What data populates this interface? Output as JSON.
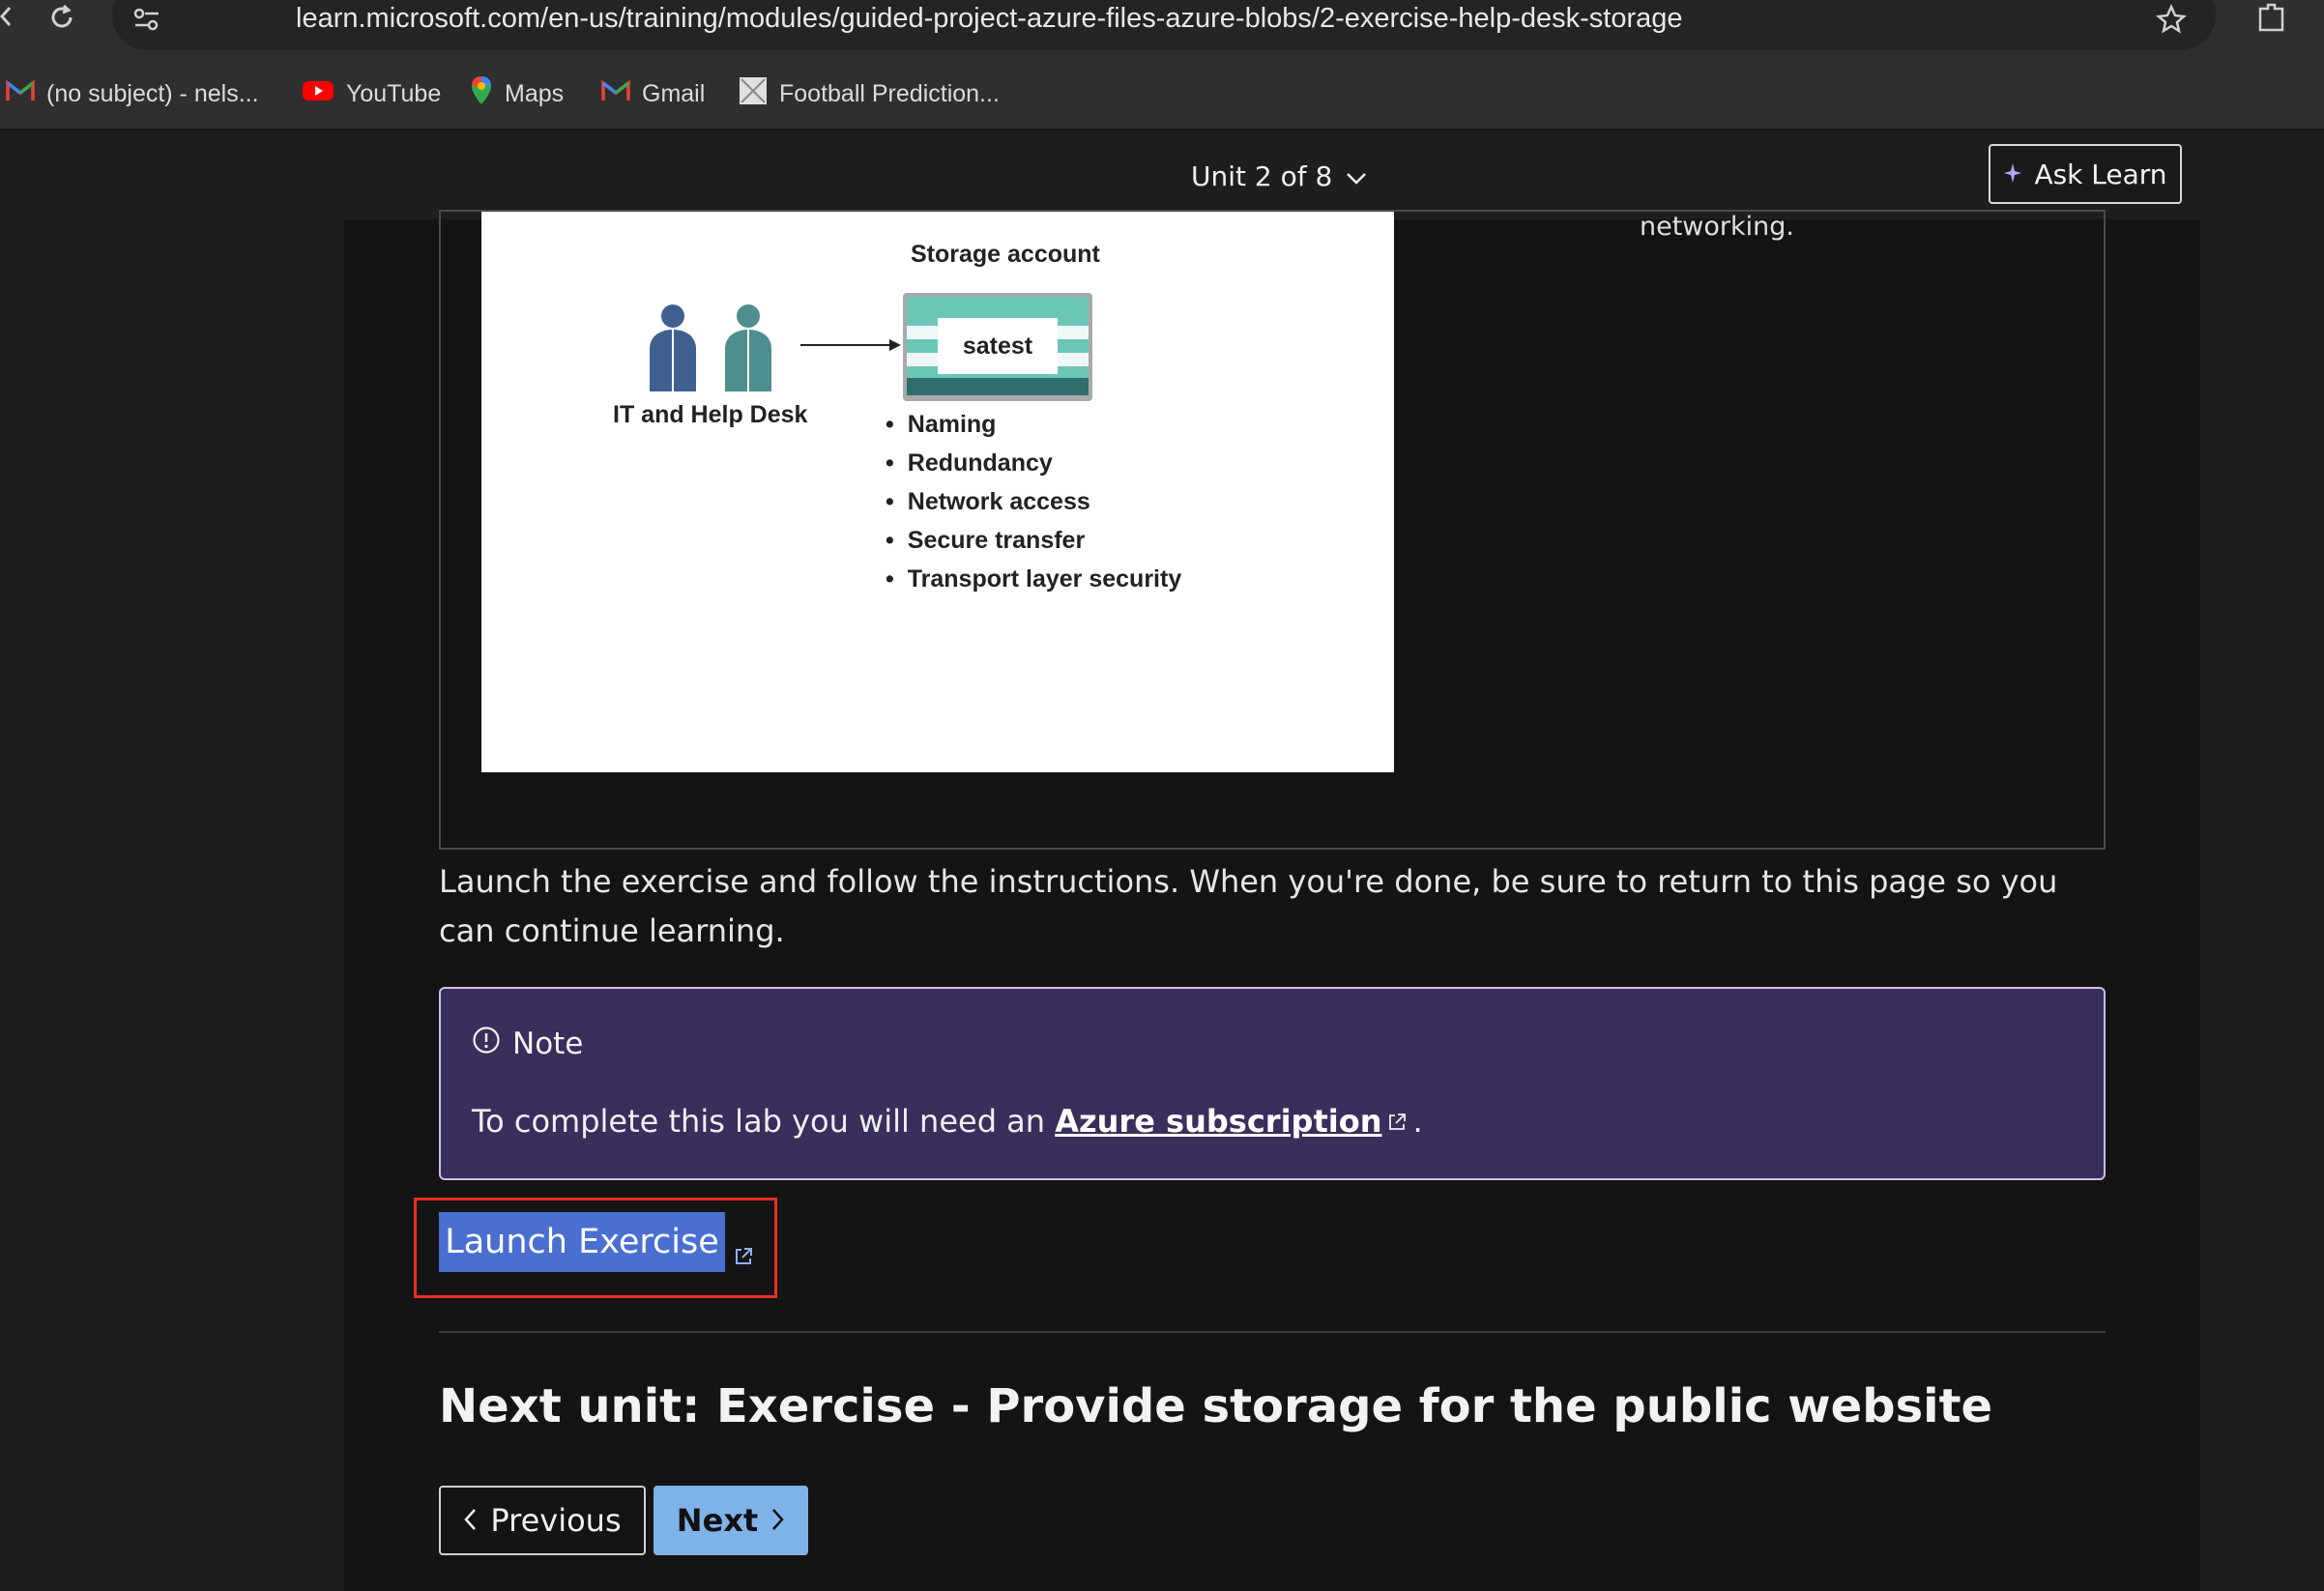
{
  "browser": {
    "url": "learn.microsoft.com/en-us/training/modules/guided-project-azure-files-azure-blobs/2-exercise-help-desk-storage",
    "bookmarks": [
      {
        "label": "(no subject) - nels...",
        "icon": "gmail-icon"
      },
      {
        "label": "YouTube",
        "icon": "youtube-icon"
      },
      {
        "label": "Maps",
        "icon": "maps-icon"
      },
      {
        "label": "Gmail",
        "icon": "gmail-icon"
      },
      {
        "label": "Football Prediction...",
        "icon": "page-icon"
      }
    ]
  },
  "header": {
    "unit_label": "Unit 2 of 8",
    "ask_learn": "Ask Learn"
  },
  "figure": {
    "people_label": "IT and Help Desk",
    "storage_title": "Storage account",
    "storage_name": "satest",
    "features": [
      "Naming",
      "Redundancy",
      "Network access",
      "Secure transfer",
      "Transport layer security"
    ]
  },
  "side_text": "networking.",
  "instructions": "Launch the exercise and follow the instructions. When you're done, be sure to return to this page so you can continue learning.",
  "note": {
    "title": "Note",
    "body_prefix": "To complete this lab you will need an ",
    "link_text": "Azure subscription",
    "body_suffix": "."
  },
  "launch_button": "Launch Exercise",
  "next_unit_title": "Next unit: Exercise - Provide storage for the public website",
  "nav": {
    "previous": "Previous",
    "next": "Next"
  },
  "colors": {
    "note_bg": "#3b2d5c",
    "launch_bg": "#4a6fd1",
    "next_bg": "#7fb2e8",
    "highlight_border": "#e8301f"
  }
}
